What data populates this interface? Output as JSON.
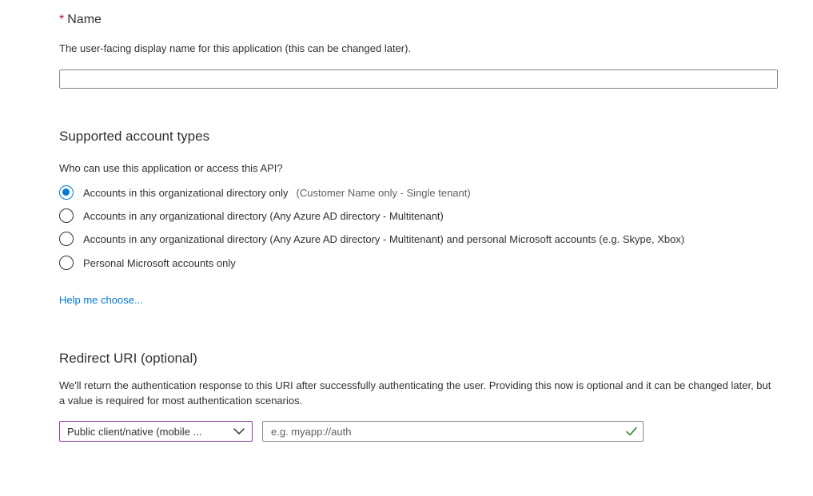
{
  "name_section": {
    "required_marker": "*",
    "label": "Name",
    "description": "The user-facing display name for this application (this can be changed later).",
    "input_value": ""
  },
  "account_types": {
    "heading": "Supported account types",
    "question": "Who can use this application or access this API?",
    "options": [
      {
        "label": "Accounts in this organizational directory only",
        "hint": "(Customer Name only - Single tenant)",
        "checked": true
      },
      {
        "label": "Accounts in any organizational directory (Any Azure AD directory - Multitenant)",
        "hint": "",
        "checked": false
      },
      {
        "label": "Accounts in any organizational directory (Any Azure AD directory - Multitenant) and personal Microsoft accounts (e.g. Skype, Xbox)",
        "hint": "",
        "checked": false
      },
      {
        "label": "Personal Microsoft accounts only",
        "hint": "",
        "checked": false
      }
    ],
    "help_link": "Help me choose..."
  },
  "redirect_uri": {
    "heading": "Redirect URI (optional)",
    "description": "We'll return the authentication response to this URI after successfully authenticating the user. Providing this now is optional and it can be changed later, but a value is required for most authentication scenarios.",
    "platform_selected": "Public client/native (mobile ...",
    "uri_placeholder": "e.g. myapp://auth",
    "uri_value": ""
  },
  "colors": {
    "accent": "#0078d4",
    "required": "#a4262c",
    "select_focus_border": "#8c3b9e",
    "valid_check": "#107c10"
  },
  "icons": {
    "radio_checked": "radio-checked-icon",
    "radio_unchecked": "radio-unchecked-icon",
    "dropdown": "chevron-down-icon",
    "valid": "checkmark-icon"
  }
}
